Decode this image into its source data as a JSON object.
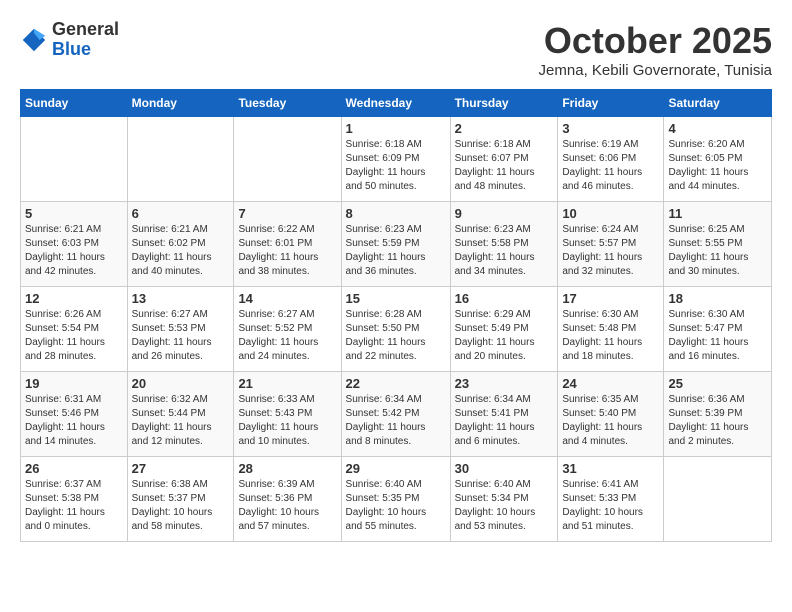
{
  "header": {
    "logo_general": "General",
    "logo_blue": "Blue",
    "month": "October 2025",
    "location": "Jemna, Kebili Governorate, Tunisia"
  },
  "days_of_week": [
    "Sunday",
    "Monday",
    "Tuesday",
    "Wednesday",
    "Thursday",
    "Friday",
    "Saturday"
  ],
  "weeks": [
    [
      {
        "day": "",
        "info": ""
      },
      {
        "day": "",
        "info": ""
      },
      {
        "day": "",
        "info": ""
      },
      {
        "day": "1",
        "info": "Sunrise: 6:18 AM\nSunset: 6:09 PM\nDaylight: 11 hours\nand 50 minutes."
      },
      {
        "day": "2",
        "info": "Sunrise: 6:18 AM\nSunset: 6:07 PM\nDaylight: 11 hours\nand 48 minutes."
      },
      {
        "day": "3",
        "info": "Sunrise: 6:19 AM\nSunset: 6:06 PM\nDaylight: 11 hours\nand 46 minutes."
      },
      {
        "day": "4",
        "info": "Sunrise: 6:20 AM\nSunset: 6:05 PM\nDaylight: 11 hours\nand 44 minutes."
      }
    ],
    [
      {
        "day": "5",
        "info": "Sunrise: 6:21 AM\nSunset: 6:03 PM\nDaylight: 11 hours\nand 42 minutes."
      },
      {
        "day": "6",
        "info": "Sunrise: 6:21 AM\nSunset: 6:02 PM\nDaylight: 11 hours\nand 40 minutes."
      },
      {
        "day": "7",
        "info": "Sunrise: 6:22 AM\nSunset: 6:01 PM\nDaylight: 11 hours\nand 38 minutes."
      },
      {
        "day": "8",
        "info": "Sunrise: 6:23 AM\nSunset: 5:59 PM\nDaylight: 11 hours\nand 36 minutes."
      },
      {
        "day": "9",
        "info": "Sunrise: 6:23 AM\nSunset: 5:58 PM\nDaylight: 11 hours\nand 34 minutes."
      },
      {
        "day": "10",
        "info": "Sunrise: 6:24 AM\nSunset: 5:57 PM\nDaylight: 11 hours\nand 32 minutes."
      },
      {
        "day": "11",
        "info": "Sunrise: 6:25 AM\nSunset: 5:55 PM\nDaylight: 11 hours\nand 30 minutes."
      }
    ],
    [
      {
        "day": "12",
        "info": "Sunrise: 6:26 AM\nSunset: 5:54 PM\nDaylight: 11 hours\nand 28 minutes."
      },
      {
        "day": "13",
        "info": "Sunrise: 6:27 AM\nSunset: 5:53 PM\nDaylight: 11 hours\nand 26 minutes."
      },
      {
        "day": "14",
        "info": "Sunrise: 6:27 AM\nSunset: 5:52 PM\nDaylight: 11 hours\nand 24 minutes."
      },
      {
        "day": "15",
        "info": "Sunrise: 6:28 AM\nSunset: 5:50 PM\nDaylight: 11 hours\nand 22 minutes."
      },
      {
        "day": "16",
        "info": "Sunrise: 6:29 AM\nSunset: 5:49 PM\nDaylight: 11 hours\nand 20 minutes."
      },
      {
        "day": "17",
        "info": "Sunrise: 6:30 AM\nSunset: 5:48 PM\nDaylight: 11 hours\nand 18 minutes."
      },
      {
        "day": "18",
        "info": "Sunrise: 6:30 AM\nSunset: 5:47 PM\nDaylight: 11 hours\nand 16 minutes."
      }
    ],
    [
      {
        "day": "19",
        "info": "Sunrise: 6:31 AM\nSunset: 5:46 PM\nDaylight: 11 hours\nand 14 minutes."
      },
      {
        "day": "20",
        "info": "Sunrise: 6:32 AM\nSunset: 5:44 PM\nDaylight: 11 hours\nand 12 minutes."
      },
      {
        "day": "21",
        "info": "Sunrise: 6:33 AM\nSunset: 5:43 PM\nDaylight: 11 hours\nand 10 minutes."
      },
      {
        "day": "22",
        "info": "Sunrise: 6:34 AM\nSunset: 5:42 PM\nDaylight: 11 hours\nand 8 minutes."
      },
      {
        "day": "23",
        "info": "Sunrise: 6:34 AM\nSunset: 5:41 PM\nDaylight: 11 hours\nand 6 minutes."
      },
      {
        "day": "24",
        "info": "Sunrise: 6:35 AM\nSunset: 5:40 PM\nDaylight: 11 hours\nand 4 minutes."
      },
      {
        "day": "25",
        "info": "Sunrise: 6:36 AM\nSunset: 5:39 PM\nDaylight: 11 hours\nand 2 minutes."
      }
    ],
    [
      {
        "day": "26",
        "info": "Sunrise: 6:37 AM\nSunset: 5:38 PM\nDaylight: 11 hours\nand 0 minutes."
      },
      {
        "day": "27",
        "info": "Sunrise: 6:38 AM\nSunset: 5:37 PM\nDaylight: 10 hours\nand 58 minutes."
      },
      {
        "day": "28",
        "info": "Sunrise: 6:39 AM\nSunset: 5:36 PM\nDaylight: 10 hours\nand 57 minutes."
      },
      {
        "day": "29",
        "info": "Sunrise: 6:40 AM\nSunset: 5:35 PM\nDaylight: 10 hours\nand 55 minutes."
      },
      {
        "day": "30",
        "info": "Sunrise: 6:40 AM\nSunset: 5:34 PM\nDaylight: 10 hours\nand 53 minutes."
      },
      {
        "day": "31",
        "info": "Sunrise: 6:41 AM\nSunset: 5:33 PM\nDaylight: 10 hours\nand 51 minutes."
      },
      {
        "day": "",
        "info": ""
      }
    ]
  ]
}
